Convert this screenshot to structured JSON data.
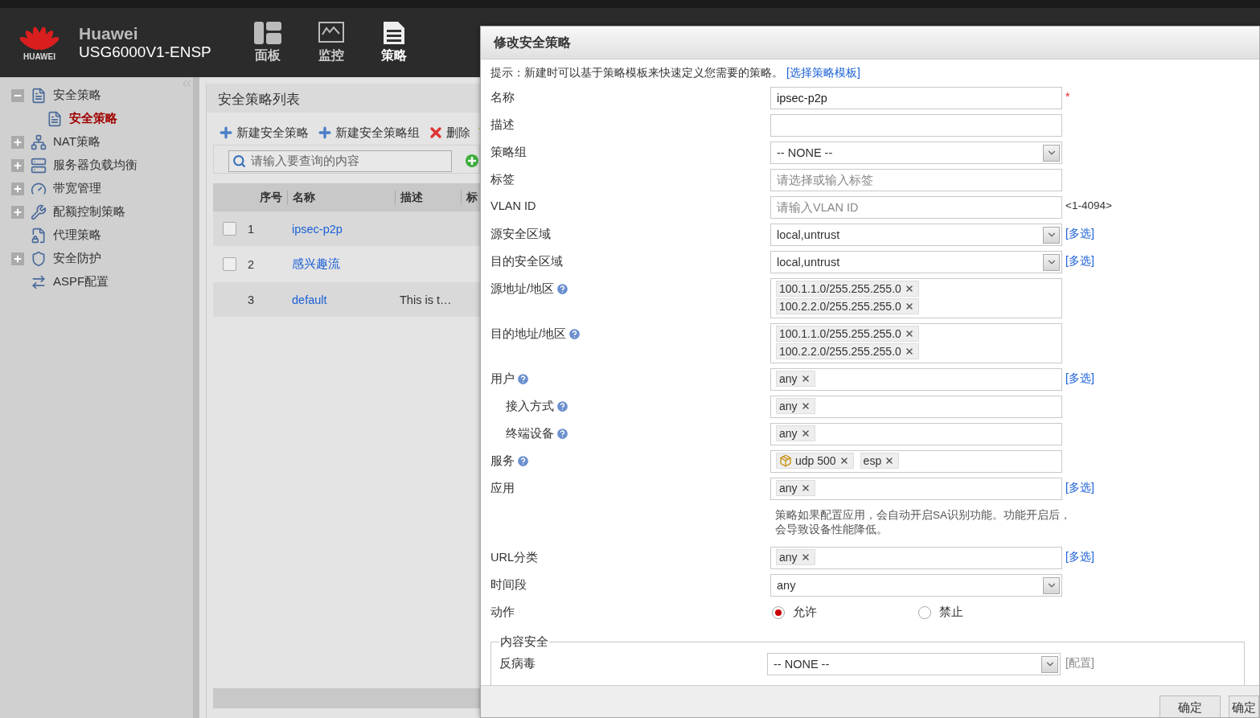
{
  "header": {
    "logo_text": "HUAWEI",
    "brand": "Huawei",
    "model": "USG6000V1-ENSP",
    "nav": [
      {
        "label": "面板",
        "selected": false
      },
      {
        "label": "监控",
        "selected": false
      },
      {
        "label": "策略",
        "selected": true
      }
    ]
  },
  "sidebar": {
    "items": [
      {
        "label": "安全策略",
        "kind": "group",
        "expanded": true,
        "children": [
          {
            "label": "安全策略",
            "selected": true
          }
        ]
      },
      {
        "label": "NAT策略",
        "kind": "group",
        "expanded": false
      },
      {
        "label": "服务器负载均衡",
        "kind": "group",
        "expanded": false
      },
      {
        "label": "带宽管理",
        "kind": "group",
        "expanded": false
      },
      {
        "label": "配额控制策略",
        "kind": "group",
        "expanded": false
      },
      {
        "label": "代理策略",
        "kind": "leaf"
      },
      {
        "label": "安全防护",
        "kind": "group",
        "expanded": false
      },
      {
        "label": "ASPF配置",
        "kind": "leaf"
      }
    ]
  },
  "panel": {
    "title": "安全策略列表",
    "toolbar": [
      "新建安全策略",
      "新建安全策略组",
      "删除"
    ],
    "search": {
      "placeholder": "请输入要查询的内容"
    },
    "table": {
      "columns": [
        "序号",
        "名称",
        "描述",
        "标"
      ],
      "rows": [
        {
          "checked": false,
          "index": "1",
          "name": "ipsec-p2p",
          "description": ""
        },
        {
          "checked": false,
          "index": "2",
          "name": "感兴趣流",
          "description": ""
        },
        {
          "index": "3",
          "name": "default",
          "description": "This is t…"
        }
      ]
    }
  },
  "dialog": {
    "title": "修改安全策略",
    "hint": "提示：新建时可以基于策略模板来快速定义您需要的策略。",
    "hint_link": "[选择策略模板]",
    "rows": [
      {
        "kind": "text",
        "label": "名称",
        "value": "ipsec-p2p",
        "required_mark": "*"
      },
      {
        "kind": "text",
        "label": "描述",
        "value": ""
      },
      {
        "kind": "select",
        "label": "策略组",
        "value": "-- NONE --"
      },
      {
        "kind": "text",
        "label": "标签",
        "placeholder": "请选择或输入标签"
      },
      {
        "kind": "text",
        "label": "VLAN ID",
        "placeholder": "请输入VLAN ID",
        "suffix": "<1-4094>"
      },
      {
        "kind": "select",
        "label": "源安全区域",
        "value": "local,untrust",
        "link": "[多选]"
      },
      {
        "kind": "select",
        "label": "目的安全区域",
        "value": "local,untrust",
        "link": "[多选]"
      },
      {
        "kind": "tags",
        "label": "源地址/地区",
        "help": true,
        "tall": true,
        "tags": [
          {
            "text": "100.1.1.0/255.255.255.0"
          },
          {
            "text": "100.2.2.0/255.255.255.0"
          }
        ]
      },
      {
        "kind": "tags",
        "label": "目的地址/地区",
        "help": true,
        "tall": true,
        "tags": [
          {
            "text": "100.1.1.0/255.255.255.0"
          },
          {
            "text": "100.2.2.0/255.255.255.0"
          }
        ]
      },
      {
        "kind": "tags",
        "label": "用户",
        "help": true,
        "link": "[多选]",
        "tags": [
          {
            "text": "any"
          }
        ],
        "children": [
          {
            "kind": "tags",
            "label": "接入方式",
            "help": true,
            "tags": [
              {
                "text": "any"
              }
            ]
          },
          {
            "kind": "tags",
            "label": "终端设备",
            "help": true,
            "tags": [
              {
                "text": "any"
              }
            ]
          }
        ]
      },
      {
        "kind": "tags",
        "label": "服务",
        "help": true,
        "tags": [
          {
            "text": "udp 500",
            "icon": true
          },
          {
            "text": "esp"
          }
        ]
      },
      {
        "kind": "tags",
        "label": "应用",
        "link": "[多选]",
        "tags": [
          {
            "text": "any"
          }
        ],
        "note": "策略如果配置应用，会自动开启SA识别功能。功能开启后，会导致设备性能降低。"
      },
      {
        "kind": "tags",
        "label": "URL分类",
        "link": "[多选]",
        "tags": [
          {
            "text": "any"
          }
        ]
      },
      {
        "kind": "select",
        "label": "时间段",
        "value": "any"
      },
      {
        "kind": "radio",
        "label": "动作",
        "options": [
          {
            "label": "允许",
            "selected": true
          },
          {
            "label": "禁止",
            "selected": false
          }
        ]
      }
    ],
    "section": {
      "legend": "内容安全",
      "rows": [
        {
          "label": "反病毒",
          "value": "-- NONE --",
          "link": "[配置]"
        }
      ]
    },
    "buttons": [
      "确定",
      "确定"
    ]
  }
}
